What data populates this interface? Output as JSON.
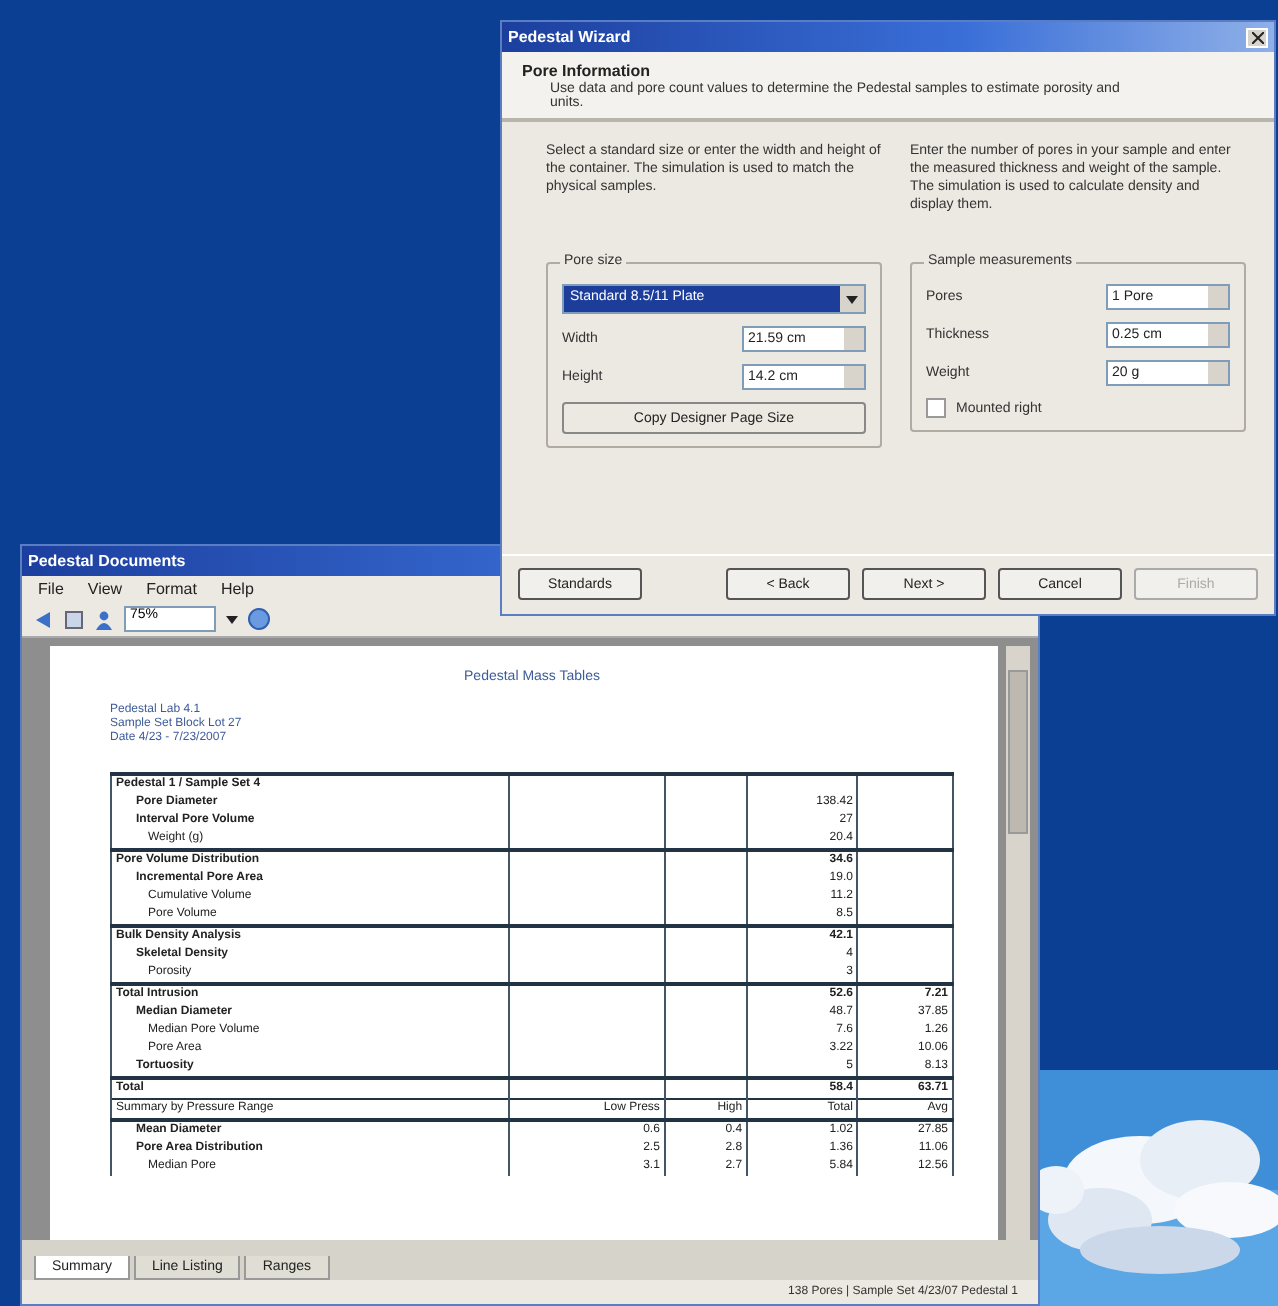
{
  "wizard": {
    "title": "Pedestal Wizard",
    "heading": "Pore Information",
    "subtitle": "Use data and pore count values to determine the Pedestal samples to estimate porosity and units.",
    "left_text": "Select a standard size or enter the width and height of the container. The simulation is used to match the physical samples.",
    "right_text": "Enter the number of pores in your sample and enter the measured thickness and weight of the sample. The simulation is used to calculate density and display them.",
    "pore_size": {
      "legend": "Pore size",
      "preset": "Standard 8.5/11 Plate",
      "fields": [
        {
          "label": "Width",
          "value": "21.59 cm"
        },
        {
          "label": "Height",
          "value": "14.2 cm"
        }
      ],
      "button": "Copy Designer Page Size"
    },
    "sample": {
      "legend": "Sample measurements",
      "fields": [
        {
          "label": "Pores",
          "value": "1 Pore"
        },
        {
          "label": "Thickness",
          "value": "0.25 cm"
        },
        {
          "label": "Weight",
          "value": "20 g"
        }
      ],
      "checkbox": {
        "label": "Mounted right",
        "checked": false
      }
    },
    "buttons": [
      {
        "label": "Standards",
        "disabled": false
      },
      {
        "label": "< Back",
        "disabled": false
      },
      {
        "label": "Next >",
        "disabled": false
      },
      {
        "label": "Cancel",
        "disabled": false
      },
      {
        "label": "Finish",
        "disabled": true
      }
    ]
  },
  "viewer": {
    "title": "Pedestal Documents",
    "menu": [
      "File",
      "View",
      "Format",
      "Help"
    ],
    "zoom": "75%",
    "document": {
      "title": "Pedestal Mass Tables",
      "address": [
        "Pedestal Lab 4.1",
        "Sample Set Block Lot 27",
        "Date 4/23 - 7/23/2007"
      ],
      "rows": [
        {
          "kind": "section",
          "label": "Pedestal 1 / Sample Set 4"
        },
        {
          "kind": "group",
          "label": "Pore Diameter",
          "col_4": "138.42"
        },
        {
          "kind": "group",
          "label": "Interval Pore Volume",
          "col_4": "27"
        },
        {
          "kind": "item",
          "label": "Weight (g)",
          "col_4": "20.4"
        },
        {
          "kind": "section",
          "label": "Pore Volume Distribution",
          "col_4": "34.6"
        },
        {
          "kind": "group",
          "label": "Incremental Pore Area",
          "col_4": "19.0"
        },
        {
          "kind": "item",
          "label": "Cumulative Volume",
          "col_4": "11.2"
        },
        {
          "kind": "item",
          "label": "Pore Volume",
          "col_4": "8.5"
        },
        {
          "kind": "section",
          "label": "Bulk Density Analysis",
          "col_4": "42.1"
        },
        {
          "kind": "group",
          "label": "Skeletal Density",
          "col_4": "4"
        },
        {
          "kind": "item",
          "label": "Porosity",
          "col_4": "3"
        },
        {
          "kind": "section",
          "label": "Total Intrusion",
          "col_4": "52.6",
          "col_5": "7.21"
        },
        {
          "kind": "group",
          "label": "Median Diameter",
          "col_4": "48.7",
          "col_5": "37.85"
        },
        {
          "kind": "item",
          "label": "Median Pore Volume",
          "col_4": "7.6",
          "col_5": "1.26"
        },
        {
          "kind": "item",
          "label": "Pore Area",
          "col_4": "3.22",
          "col_5": "10.06"
        },
        {
          "kind": "group",
          "label": "Tortuosity",
          "col_4": "5",
          "col_5": "8.13"
        },
        {
          "kind": "section",
          "label": "Total",
          "col_4": "58.4",
          "col_5": "63.71"
        },
        {
          "kind": "header",
          "label": "Summary by Pressure Range",
          "col_2": "Low Press",
          "col_3": "High",
          "col_4": "Total",
          "col_5": "Avg"
        },
        {
          "kind": "group",
          "label": "Mean Diameter",
          "col_2": "0.6",
          "col_3": "0.4",
          "col_4": "1.02",
          "col_5": "27.85"
        },
        {
          "kind": "group",
          "label": "Pore Area Distribution",
          "col_2": "2.5",
          "col_3": "2.8",
          "col_4": "1.36",
          "col_5": "11.06"
        },
        {
          "kind": "item",
          "label": "Median Pore",
          "col_2": "3.1",
          "col_3": "2.7",
          "col_4": "5.84",
          "col_5": "12.56"
        }
      ]
    },
    "tabs": [
      {
        "label": "Summary",
        "selected": true
      },
      {
        "label": "Line Listing",
        "selected": false
      },
      {
        "label": "Ranges",
        "selected": false
      }
    ],
    "status": "138 Pores | Sample Set 4/23/07 Pedestal 1"
  }
}
